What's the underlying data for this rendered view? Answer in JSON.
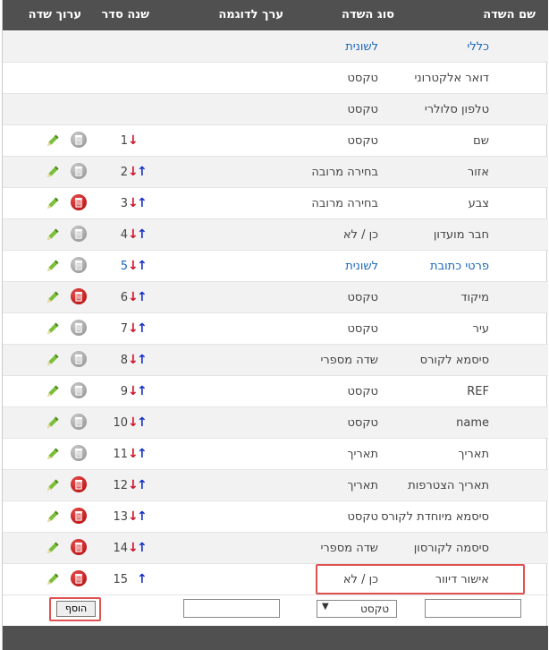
{
  "header": {
    "col_name": "שם השדה",
    "col_type": "סוג השדה",
    "col_example": "ערך לדוגמה",
    "col_order": "שנה סדר",
    "col_edit": "ערוך שדה"
  },
  "rows": [
    {
      "name": "כללי",
      "type": "לשונית",
      "order": "",
      "name_link": true,
      "type_link": true,
      "up": false,
      "down": false,
      "edit": false,
      "trash": ""
    },
    {
      "name": "דואר אלקטרוני",
      "type": "טקסט",
      "order": "",
      "up": false,
      "down": false,
      "edit": false,
      "trash": ""
    },
    {
      "name": "טלפון סלולרי",
      "type": "טקסט",
      "order": "",
      "up": false,
      "down": false,
      "edit": false,
      "trash": ""
    },
    {
      "name": "שם",
      "type": "טקסט",
      "order": "1",
      "up": false,
      "down": true,
      "edit": true,
      "trash": "gray"
    },
    {
      "name": "אזור",
      "type": "בחירה מרובה",
      "order": "2",
      "up": true,
      "down": true,
      "edit": true,
      "trash": "gray"
    },
    {
      "name": "צבע",
      "type": "בחירה מרובה",
      "order": "3",
      "up": true,
      "down": true,
      "edit": true,
      "trash": "red"
    },
    {
      "name": "חבר מועדון",
      "type": "כן / לא",
      "order": "4",
      "up": true,
      "down": true,
      "edit": true,
      "trash": "gray"
    },
    {
      "name": "פרטי כתובת",
      "type": "לשונית",
      "order": "5",
      "name_link": true,
      "type_link": true,
      "order_link": true,
      "up": true,
      "down": true,
      "edit": true,
      "trash": "gray"
    },
    {
      "name": "מיקוד",
      "type": "טקסט",
      "order": "6",
      "up": true,
      "down": true,
      "edit": true,
      "trash": "red"
    },
    {
      "name": "עיר",
      "type": "טקסט",
      "order": "7",
      "up": true,
      "down": true,
      "edit": true,
      "trash": "gray"
    },
    {
      "name": "סיסמא לקורס",
      "type": "שדה מספרי",
      "order": "8",
      "up": true,
      "down": true,
      "edit": true,
      "trash": "gray"
    },
    {
      "name": "REF",
      "type": "טקסט",
      "order": "9",
      "up": true,
      "down": true,
      "edit": true,
      "trash": "gray"
    },
    {
      "name": "name",
      "type": "טקסט",
      "order": "10",
      "up": true,
      "down": true,
      "edit": true,
      "trash": "gray"
    },
    {
      "name": "תאריך",
      "type": "תאריך",
      "order": "11",
      "up": true,
      "down": true,
      "edit": true,
      "trash": "gray"
    },
    {
      "name": "תאריך הצטרפות",
      "type": "תאריך",
      "order": "12",
      "up": true,
      "down": true,
      "edit": true,
      "trash": "red"
    },
    {
      "name": "סיסמא מיוחדת לקורס",
      "type": "טקסט",
      "order": "13",
      "up": true,
      "down": true,
      "edit": true,
      "trash": "red"
    },
    {
      "name": "סיסמה לקורסון",
      "type": "שדה מספרי",
      "order": "14",
      "up": true,
      "down": true,
      "edit": true,
      "trash": "red"
    },
    {
      "name": "אישור דיוור",
      "type": "כן / לא",
      "order": "15",
      "up": true,
      "down": false,
      "edit": true,
      "trash": "red"
    }
  ],
  "add_row": {
    "type_select_value": "טקסט",
    "add_button_label": "הוסף",
    "name_value": "",
    "example_value": ""
  },
  "colors": {
    "header_bg": "#505050",
    "link": "#1a66b8",
    "arrow_up": "#1530c8",
    "arrow_down": "#d0102a",
    "pencil": "#7cc03a",
    "highlight": "#e05252"
  },
  "icons": {
    "edit": "pencil-icon",
    "delete": "trash-icon",
    "up": "arrow-up-icon",
    "down": "arrow-down-icon"
  }
}
